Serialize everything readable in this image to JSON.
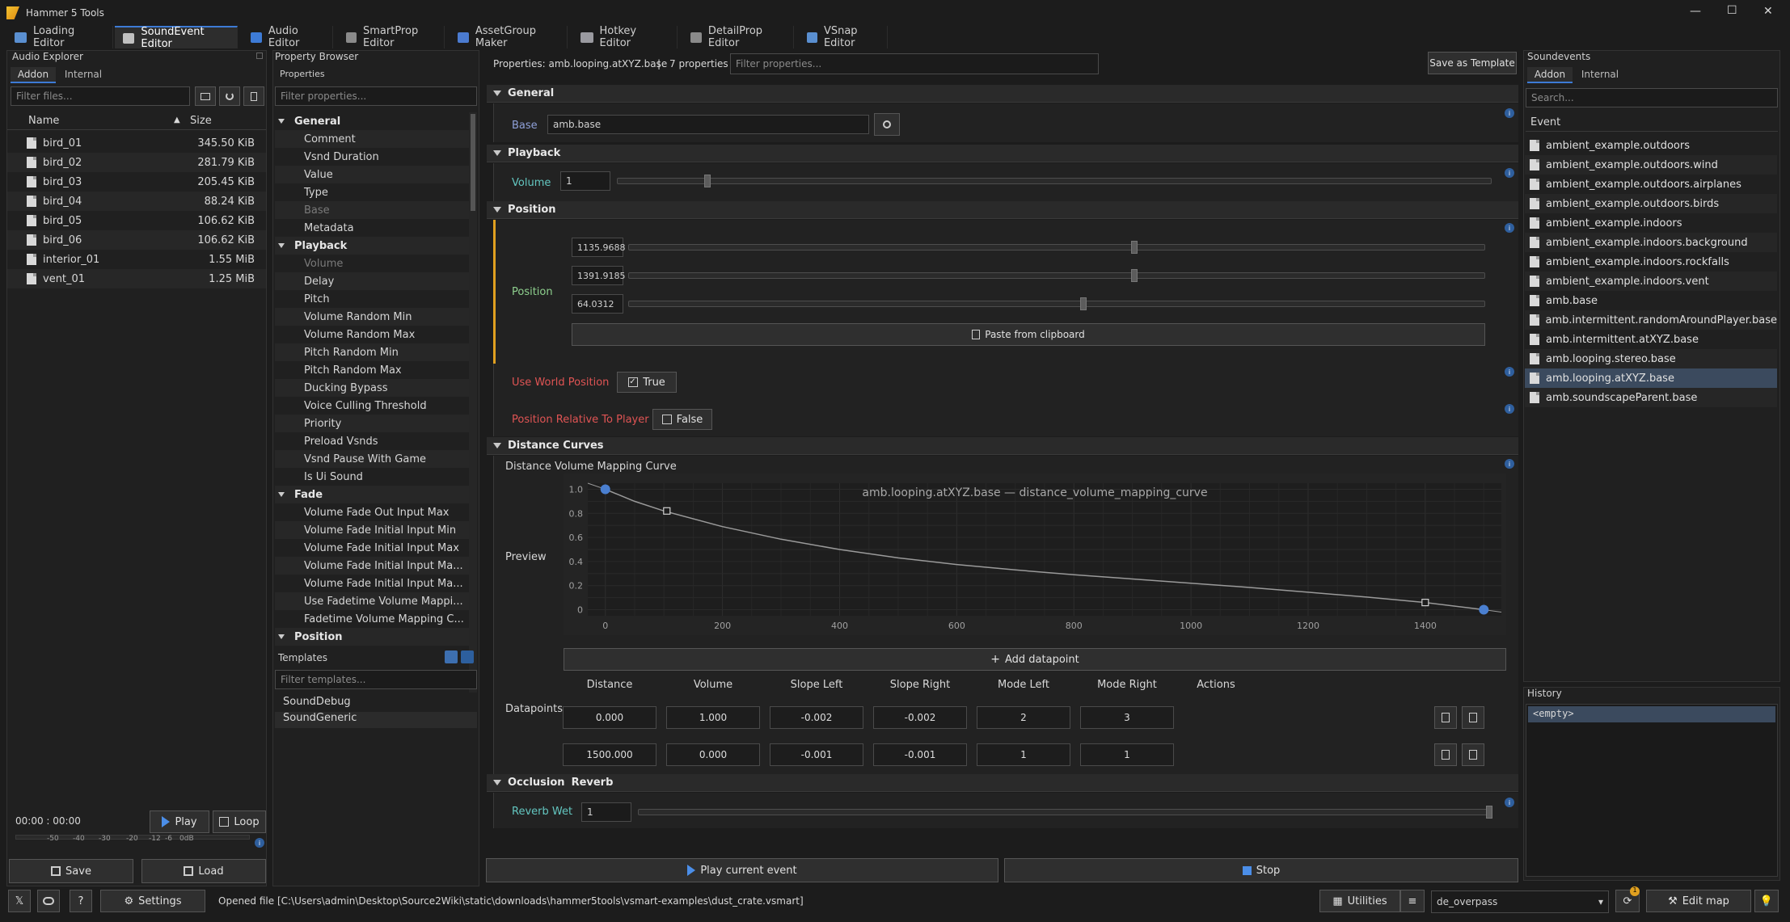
{
  "window": {
    "title": "Hammer 5 Tools",
    "min": "—",
    "max": "☐",
    "close": "✕"
  },
  "tabs": [
    "Loading Editor",
    "SoundEvent Editor",
    "Audio Editor",
    "SmartProp Editor",
    "AssetGroup Maker",
    "Hotkey Editor",
    "DetailProp Editor",
    "VSnap Editor"
  ],
  "audio_explorer": {
    "title": "Audio Explorer",
    "subtabs": [
      "Addon",
      "Internal"
    ],
    "filter_placeholder": "Filter files...",
    "col_name": "Name",
    "col_size": "Size",
    "files": [
      {
        "name": "bird_01",
        "size": "345.50 KiB"
      },
      {
        "name": "bird_02",
        "size": "281.79 KiB"
      },
      {
        "name": "bird_03",
        "size": "205.45 KiB"
      },
      {
        "name": "bird_04",
        "size": "88.24 KiB"
      },
      {
        "name": "bird_05",
        "size": "106.62 KiB"
      },
      {
        "name": "bird_06",
        "size": "106.62 KiB"
      },
      {
        "name": "interior_01",
        "size": "1.55 MiB"
      },
      {
        "name": "vent_01",
        "size": "1.25 MiB"
      }
    ],
    "time": "00:00 : 00:00",
    "play": "Play",
    "loop": "Loop",
    "meter_ticks": [
      "-50",
      "-40",
      "-30",
      "-20",
      "-12",
      "-6",
      "0dB"
    ],
    "save": "Save",
    "load": "Load"
  },
  "property_browser": {
    "title": "Property Browser",
    "subtitle": "Properties",
    "filter_placeholder": "Filter properties...",
    "tree": [
      {
        "text": "General",
        "group": true
      },
      {
        "text": "Comment"
      },
      {
        "text": "Vsnd Duration"
      },
      {
        "text": "Value"
      },
      {
        "text": "Type"
      },
      {
        "text": "Base",
        "dim": true
      },
      {
        "text": "Metadata"
      },
      {
        "text": "Playback",
        "group": true
      },
      {
        "text": "Volume",
        "dim": true
      },
      {
        "text": "Delay"
      },
      {
        "text": "Pitch"
      },
      {
        "text": "Volume Random Min"
      },
      {
        "text": "Volume Random Max"
      },
      {
        "text": "Pitch Random Min"
      },
      {
        "text": "Pitch Random Max"
      },
      {
        "text": "Ducking Bypass"
      },
      {
        "text": "Voice Culling Threshold"
      },
      {
        "text": "Priority"
      },
      {
        "text": "Preload Vsnds"
      },
      {
        "text": "Vsnd Pause With Game"
      },
      {
        "text": "Is Ui Sound"
      },
      {
        "text": "Fade",
        "group": true
      },
      {
        "text": "Volume Fade Out Input Max"
      },
      {
        "text": "Volume Fade Initial Input Min"
      },
      {
        "text": "Volume Fade Initial Input Max"
      },
      {
        "text": "Volume Fade Initial Input Ma..."
      },
      {
        "text": "Volume Fade Initial Input Ma..."
      },
      {
        "text": "Use Fadetime Volume Mappi..."
      },
      {
        "text": "Fadetime Volume Mapping C..."
      },
      {
        "text": "Position",
        "group": true
      }
    ],
    "templates_title": "Templates",
    "templates_filter": "Filter templates...",
    "templates": [
      "SoundDebug",
      "SoundGeneric"
    ]
  },
  "properties": {
    "header": "Properties: amb.looping.atXYZ.base",
    "separator": "|",
    "count": "7 properties",
    "filter_placeholder": "Filter properties...",
    "save_template": "Save as Template",
    "general": {
      "title": "General",
      "base_label": "Base",
      "base_value": "amb.base"
    },
    "playback": {
      "title": "Playback",
      "volume_label": "Volume",
      "volume_value": "1",
      "volume_level": 0.1
    },
    "position": {
      "title": "Position",
      "label": "Position",
      "x": "1135.9688",
      "y": "1391.9185",
      "z": "64.0312",
      "x_level": 0.59,
      "y_level": 0.59,
      "z_level": 0.53,
      "paste": "Paste from clipboard",
      "use_world_label": "Use World Position",
      "use_world_value": "True",
      "relative_label": "Position Relative To Player",
      "relative_value": "False"
    },
    "distance": {
      "title": "Distance Curves",
      "curve_label": "Distance Volume Mapping Curve",
      "preview_label": "Preview",
      "add_datapoint": "Add datapoint",
      "datapoints_label": "Datapoints",
      "cols": [
        "Distance",
        "Volume",
        "Slope Left",
        "Slope Right",
        "Mode Left",
        "Mode Right",
        "Actions"
      ],
      "rows": [
        [
          "0.000",
          "1.000",
          "-0.002",
          "-0.002",
          "2",
          "3"
        ],
        [
          "1500.000",
          "0.000",
          "-0.001",
          "-0.001",
          "1",
          "1"
        ]
      ]
    },
    "occlusion": {
      "title": "Occlusion",
      "reverb_title": "Reverb",
      "reverb_label": "Reverb Wet",
      "reverb_value": "1",
      "reverb_level": 1.0
    },
    "play_current": "Play current event",
    "stop": "Stop"
  },
  "chart_data": {
    "type": "line",
    "title": "amb.looping.atXYZ.base — distance_volume_mapping_curve",
    "xlim": [
      -30,
      1530
    ],
    "ylim": [
      -0.05,
      1.05
    ],
    "xticks": [
      "0",
      "200",
      "400",
      "600",
      "800",
      "1000",
      "1200",
      "1400"
    ],
    "yticks": [
      "1.0",
      "0.8",
      "0.6",
      "0.4",
      "0.2",
      "0"
    ],
    "series": [
      {
        "values": [
          [
            0,
            1.0
          ],
          [
            50,
            0.9
          ],
          [
            100,
            0.82
          ],
          [
            200,
            0.69
          ],
          [
            300,
            0.585
          ],
          [
            400,
            0.5
          ],
          [
            500,
            0.43
          ],
          [
            600,
            0.375
          ],
          [
            700,
            0.33
          ],
          [
            800,
            0.29
          ],
          [
            900,
            0.255
          ],
          [
            1000,
            0.22
          ],
          [
            1100,
            0.185
          ],
          [
            1200,
            0.145
          ],
          [
            1300,
            0.105
          ],
          [
            1400,
            0.06
          ],
          [
            1500,
            0.0
          ]
        ]
      }
    ],
    "points": [
      [
        0,
        1.0
      ],
      [
        1500,
        0.0
      ]
    ],
    "handles": [
      [
        105,
        0.82
      ],
      [
        1400,
        0.06
      ]
    ],
    "grid": true
  },
  "soundevents": {
    "title": "Soundevents",
    "subtabs": [
      "Addon",
      "Internal"
    ],
    "search_placeholder": "Search...",
    "col": "Event",
    "events": [
      "ambient_example.outdoors",
      "ambient_example.outdoors.wind",
      "ambient_example.outdoors.airplanes",
      "ambient_example.outdoors.birds",
      "ambient_example.indoors",
      "ambient_example.indoors.background",
      "ambient_example.indoors.rockfalls",
      "ambient_example.indoors.vent",
      "amb.base",
      "amb.intermittent.randomAroundPlayer.base",
      "amb.intermittent.atXYZ.base",
      "amb.looping.stereo.base",
      "amb.looping.atXYZ.base",
      "amb.soundscapeParent.base"
    ],
    "selected_index": 12
  },
  "history": {
    "title": "History",
    "item": "<empty>"
  },
  "statusbar": {
    "settings": "Settings",
    "opened": "Opened file [C:\\Users\\admin\\Desktop\\Source2Wiki\\static\\downloads\\hammer5tools\\vsmart-examples\\dust_crate.vsmart]",
    "utilities": "Utilities",
    "map": "de_overpass",
    "badge": "1",
    "edit_map": "Edit map"
  }
}
